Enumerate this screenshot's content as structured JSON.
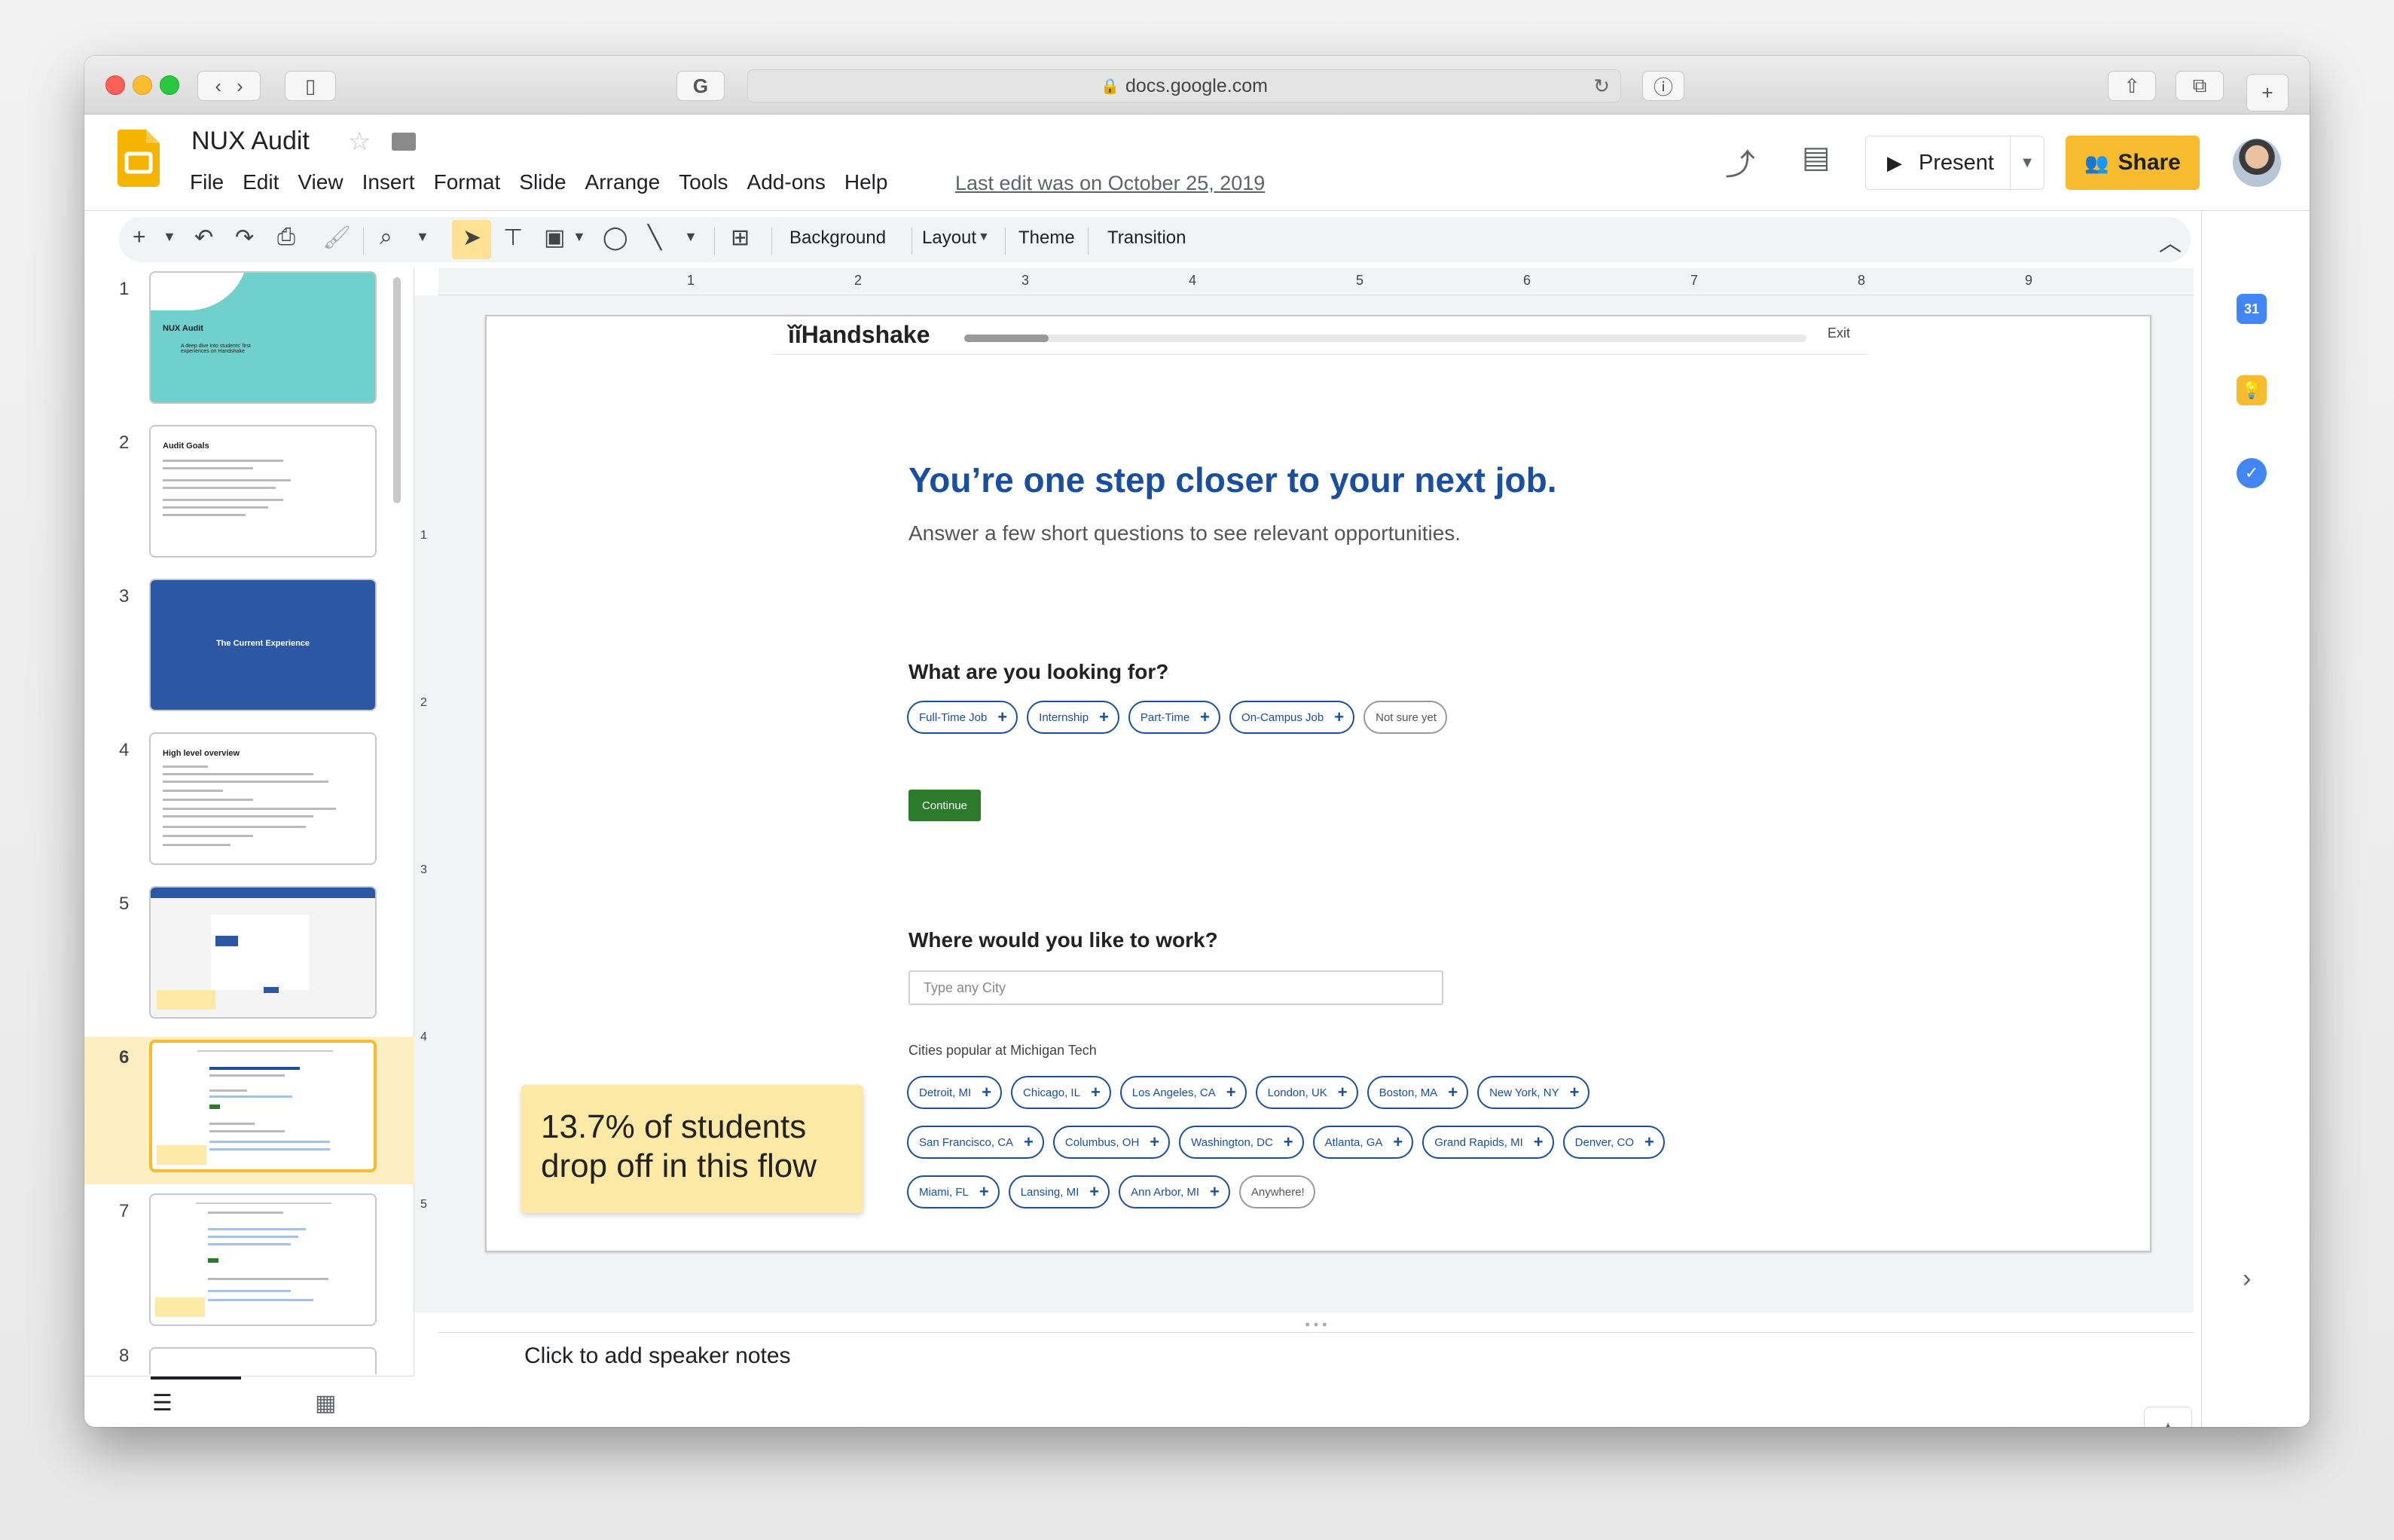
{
  "browser": {
    "url": "docs.google.com"
  },
  "doc": {
    "title": "NUX Audit",
    "last_edit": "Last edit was on October 25, 2019",
    "menu": [
      "File",
      "Edit",
      "View",
      "Insert",
      "Format",
      "Slide",
      "Arrange",
      "Tools",
      "Add-ons",
      "Help"
    ],
    "present_label": "Present",
    "share_label": "Share"
  },
  "toolbar": {
    "background_label": "Background",
    "layout_label": "Layout",
    "theme_label": "Theme",
    "transition_label": "Transition"
  },
  "filmstrip": {
    "slides": [
      {
        "num": "1",
        "title": "NUX Audit",
        "subtitle": "A deep dive into students' first experiences on Handshake"
      },
      {
        "num": "2",
        "title": "Audit Goals"
      },
      {
        "num": "3",
        "title": "The Current Experience"
      },
      {
        "num": "4",
        "title": "High level overview"
      },
      {
        "num": "5",
        "title": ""
      },
      {
        "num": "6",
        "title": ""
      },
      {
        "num": "7",
        "title": ""
      },
      {
        "num": "8",
        "title": ""
      }
    ],
    "active_index": 6
  },
  "ruler": {
    "h": [
      "1",
      "2",
      "3",
      "4",
      "5",
      "6",
      "7",
      "8",
      "9"
    ],
    "v": [
      "1",
      "2",
      "3",
      "4",
      "5"
    ]
  },
  "slide": {
    "logo": "Handshake",
    "exit": "Exit",
    "headline": "You’re one step closer to your next job.",
    "subhead": "Answer a few short questions to see relevant opportunities.",
    "q1": "What are you looking for?",
    "job_types": [
      "Full-Time Job",
      "Internship",
      "Part-Time",
      "On-Campus Job"
    ],
    "not_sure": "Not sure yet",
    "continue": "Continue",
    "q2": "Where would you like to work?",
    "city_placeholder": "Type any City",
    "cities_label": "Cities popular at Michigan Tech",
    "cities_row1": [
      "Detroit, MI",
      "Chicago, IL",
      "Los Angeles, CA",
      "London, UK",
      "Boston, MA",
      "New York, NY"
    ],
    "cities_row2": [
      "San Francisco, CA",
      "Columbus, OH",
      "Washington, DC",
      "Atlanta, GA",
      "Grand Rapids, MI",
      "Denver, CO"
    ],
    "cities_row3": [
      "Miami, FL",
      "Lansing, MI",
      "Ann Arbor, MI"
    ],
    "anywhere": "Anywhere!",
    "stat_note": "13.7% of students drop off in this flow"
  },
  "notes": {
    "placeholder": "Click to add speaker notes"
  },
  "side_panel": {
    "calendar_label": "31"
  },
  "colors": {
    "accent_yellow": "#f6bb2f",
    "handshake_blue": "#1a4fa0",
    "continue_green": "#2c7a2c",
    "note_yellow": "#fde9a6",
    "active_slide_bg": "#feefc3"
  }
}
